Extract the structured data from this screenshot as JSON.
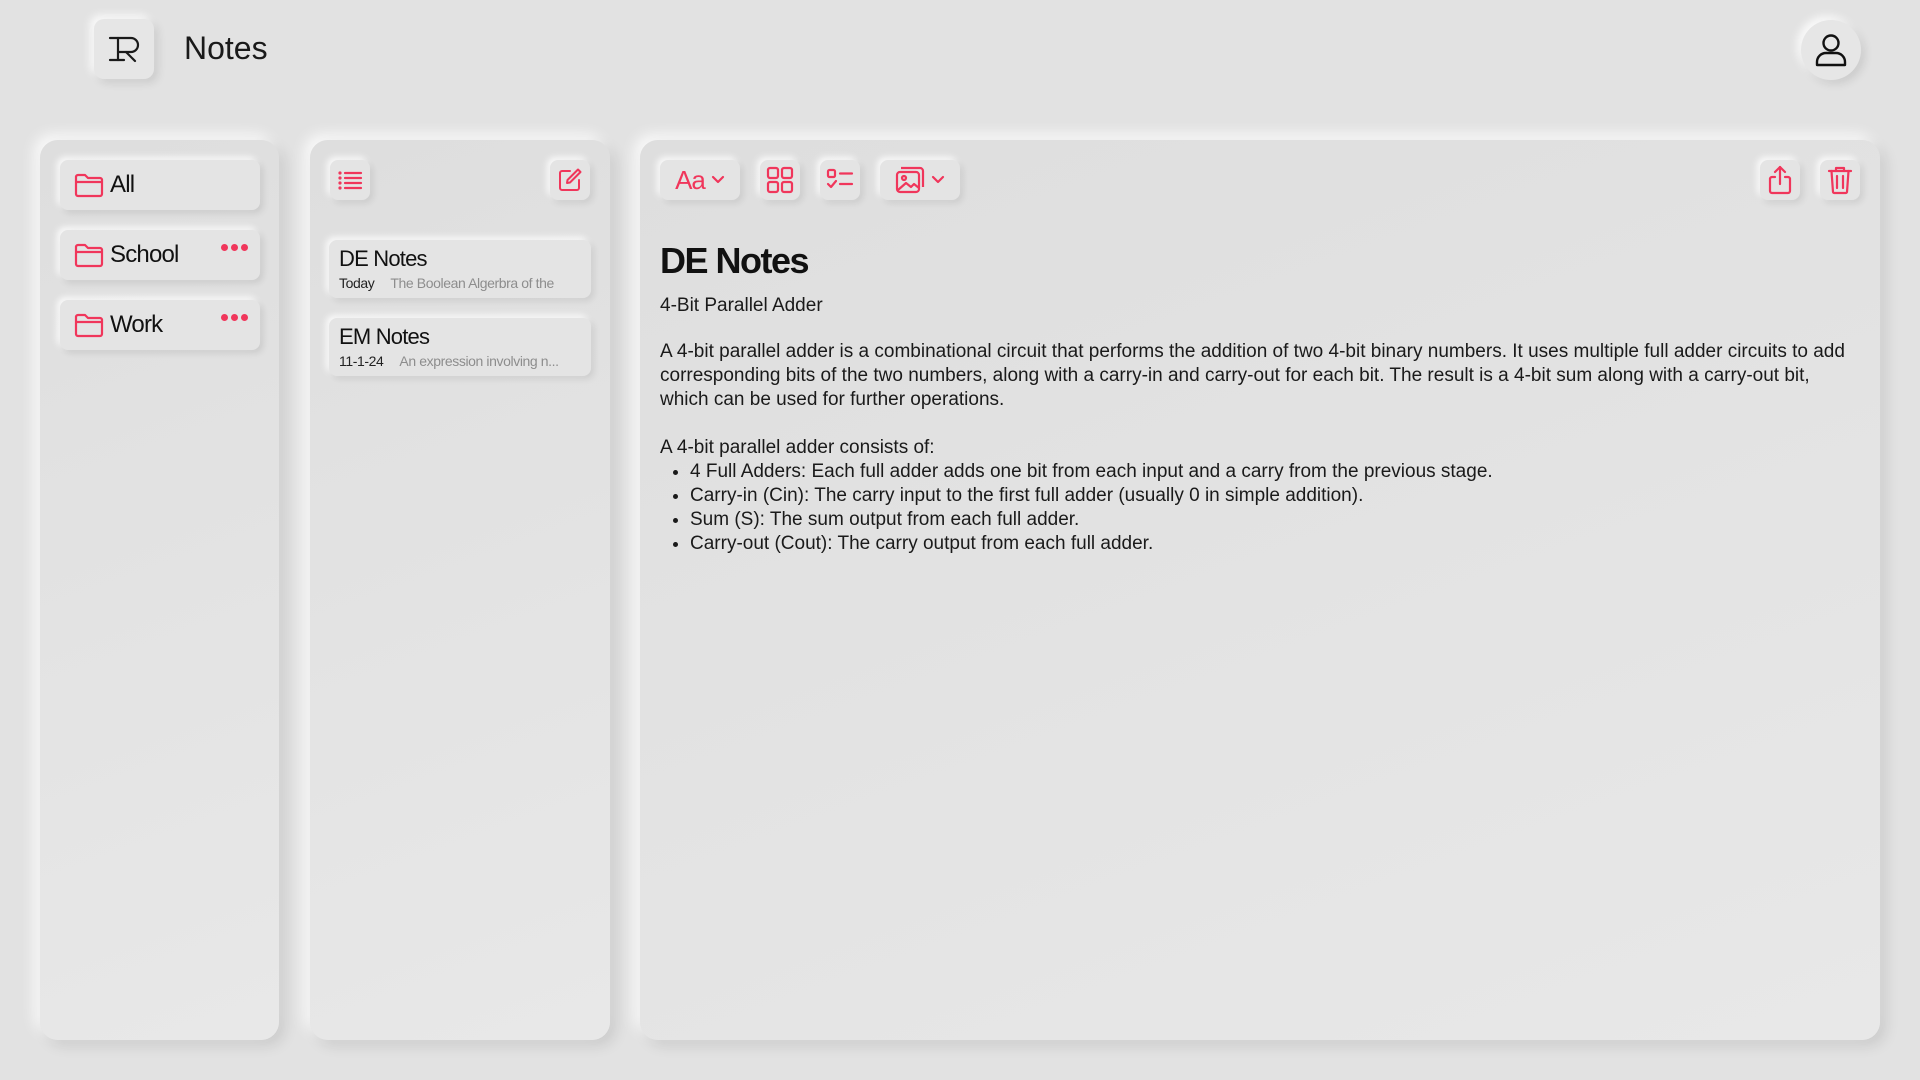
{
  "app": {
    "logo_letter": "R",
    "title": "Notes",
    "accent_color": "#f0365b"
  },
  "folders": [
    {
      "label": "All",
      "icon": "folder-icon",
      "has_menu": false
    },
    {
      "label": "School",
      "icon": "folder-icon",
      "has_menu": true
    },
    {
      "label": "Work",
      "icon": "folder-icon",
      "has_menu": true
    }
  ],
  "notes_toolbar": {
    "list_icon": "list-icon",
    "compose_icon": "compose-icon"
  },
  "notes": [
    {
      "title": "DE Notes",
      "date": "Today",
      "preview": "The Boolean Algerbra of the"
    },
    {
      "title": "EM Notes",
      "date": "11-1-24",
      "preview": "An expression involving n..."
    }
  ],
  "editor_toolbar": {
    "text_format_label": "Aa",
    "icons": [
      "text-format-icon",
      "grid-icon",
      "checklist-icon",
      "image-icon",
      "share-icon",
      "trash-icon"
    ]
  },
  "document": {
    "title": "DE Notes",
    "subtitle": "4-Bit Parallel Adder",
    "paragraph": "A 4-bit parallel adder is a combinational circuit that performs the addition of two 4-bit binary numbers. It uses multiple full adder circuits to add corresponding bits of the two numbers, along with a carry-in and carry-out for each bit. The result is a 4-bit sum along with a carry-out bit, which can be used for further operations.",
    "list_intro": "A 4-bit parallel adder consists of:",
    "list_items": [
      "4 Full Adders: Each full adder adds one bit from each input and a carry from the previous stage.",
      "Carry-in (Cin): The carry input to the first full adder (usually 0 in simple addition).",
      "Sum (S): The sum output from each full adder.",
      "Carry-out (Cout): The carry output from each full adder."
    ]
  }
}
